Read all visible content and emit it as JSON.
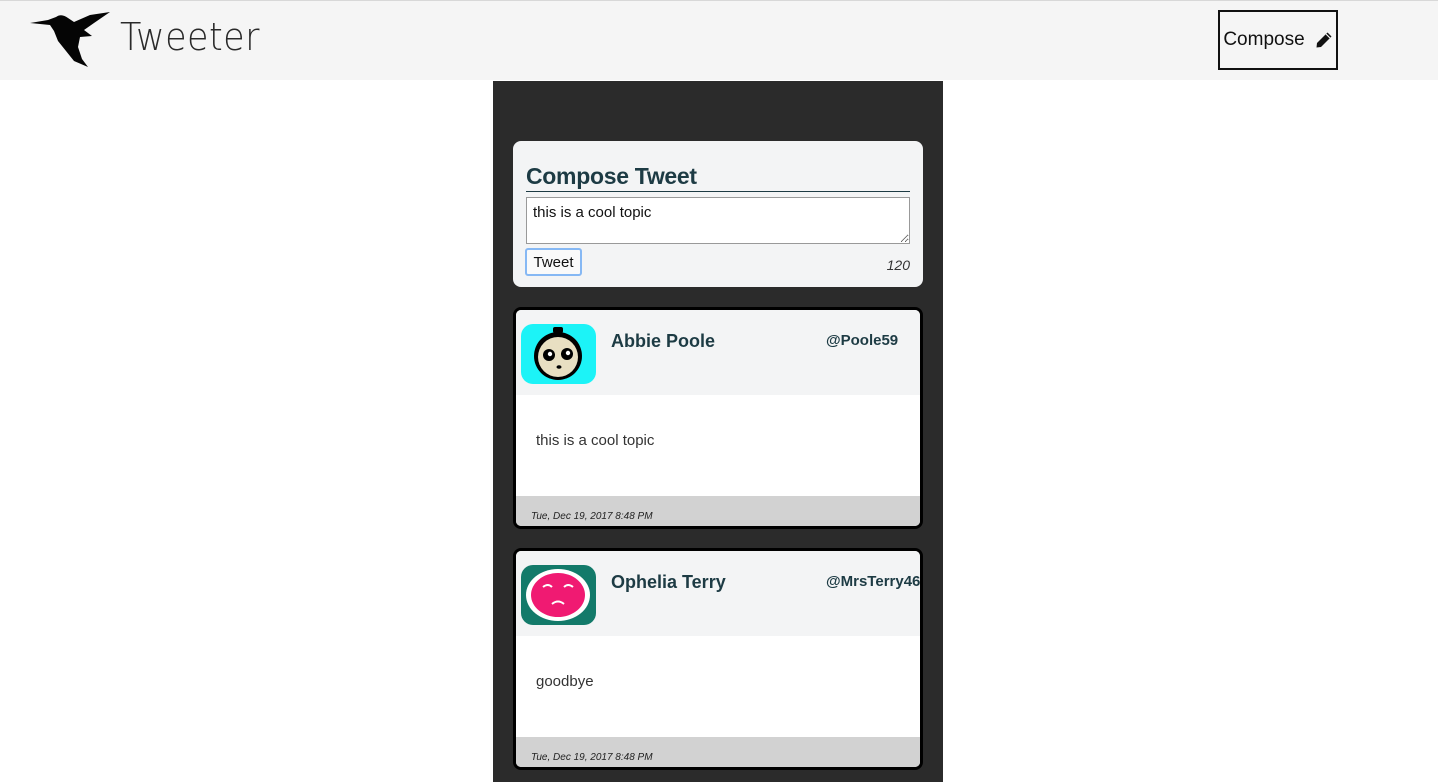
{
  "header": {
    "brand": "Tweeter",
    "compose_label": "Compose"
  },
  "compose": {
    "title": "Compose Tweet",
    "text": "this is a cool topic",
    "button_label": "Tweet",
    "counter": "120"
  },
  "tweets": [
    {
      "name": "Abbie Poole",
      "handle": "@Poole59",
      "text": "this is a cool topic",
      "timestamp": "Tue, Dec 19, 2017 8:48 PM",
      "avatar_bg": "#1cf3f7"
    },
    {
      "name": "Ophelia Terry",
      "handle": "@MrsTerry46",
      "text": "goodbye",
      "timestamp": "Tue, Dec 19, 2017 8:48 PM",
      "avatar_bg": "#137a6a"
    }
  ],
  "colors": {
    "nav_bg": "#f5f5f5",
    "feed_bg": "#2b2b2b",
    "accent_text": "#1d3b44"
  }
}
